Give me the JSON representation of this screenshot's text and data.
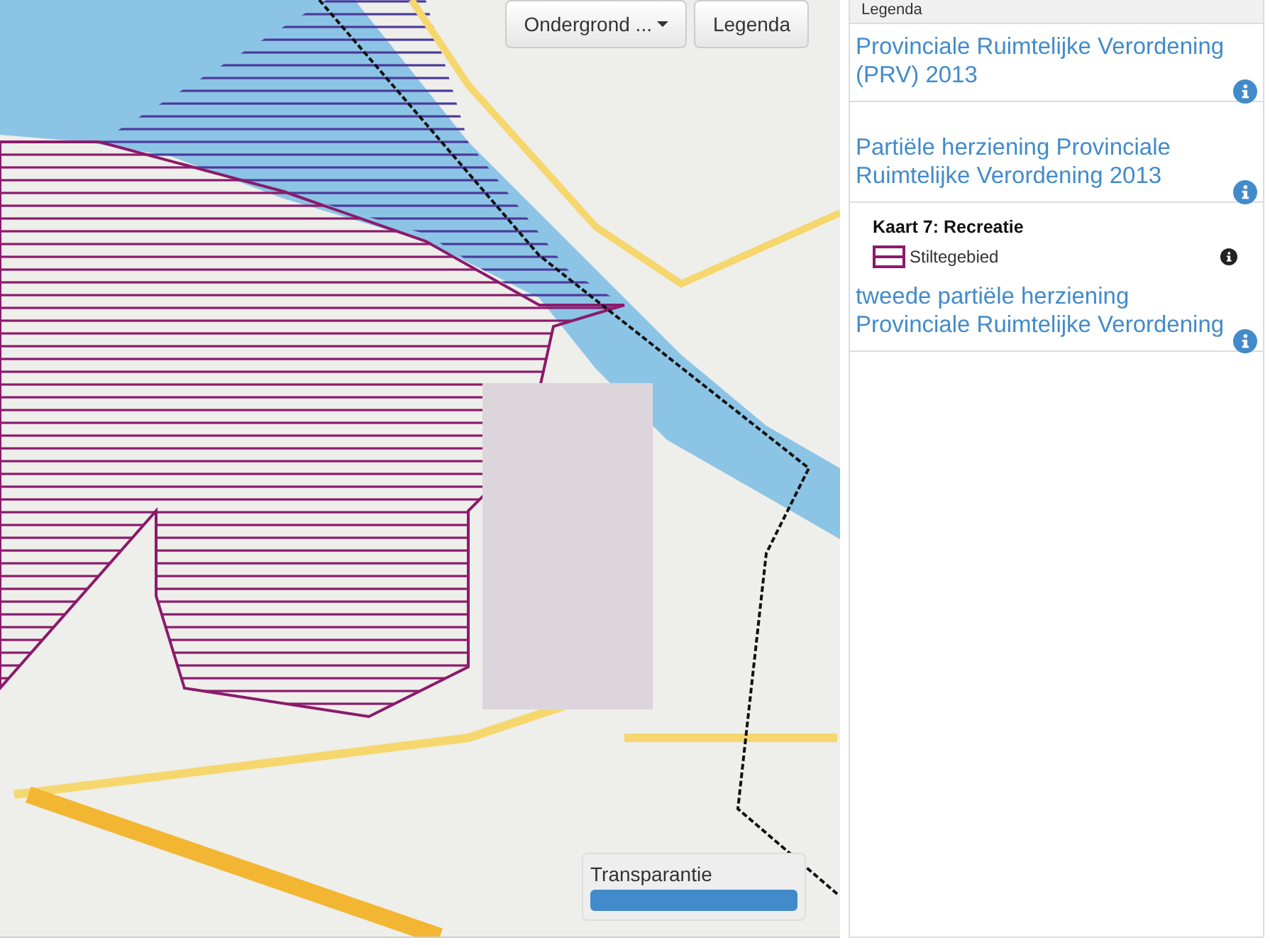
{
  "map_controls": {
    "basemap_button": {
      "label": "Ondergrond ..."
    },
    "legend_button": {
      "label": "Legenda"
    }
  },
  "transparency": {
    "label": "Transparantie",
    "level": 1
  },
  "legend_panel": {
    "title": "Legenda",
    "layers": [
      {
        "title": "Provinciale Ruimtelijke Verordening (PRV) 2013"
      },
      {
        "title": "Partiële herziening Provinciale Ruimtelijke Verordening 2013",
        "map": {
          "heading": "Kaart 7: Recreatie",
          "items": [
            {
              "label": "Stiltegebied"
            }
          ]
        }
      },
      {
        "title": "tweede partiële herziening Provinciale Ruimtelijke Verordening"
      }
    ]
  }
}
